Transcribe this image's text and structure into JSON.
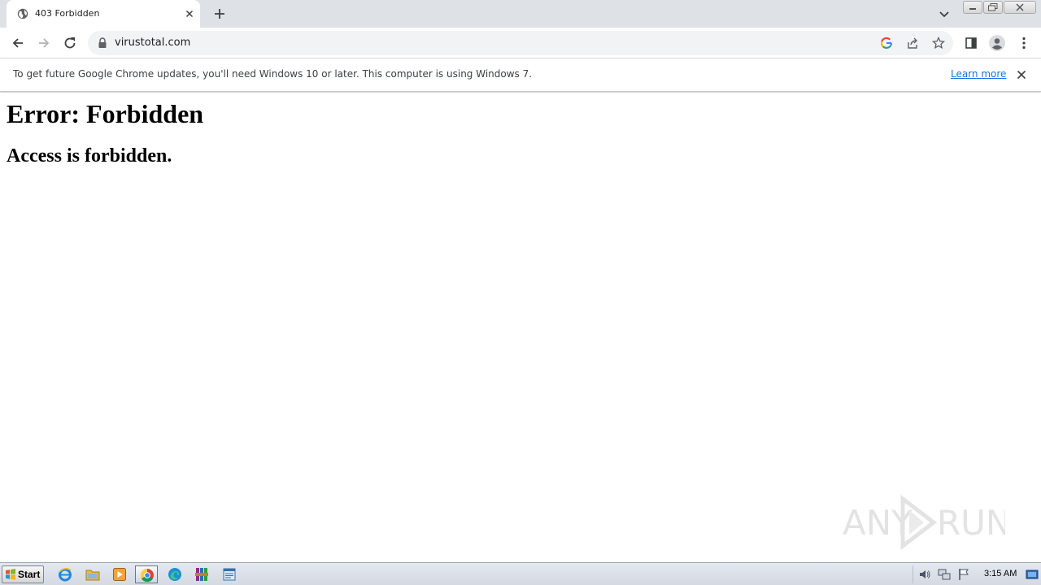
{
  "browser": {
    "tab": {
      "title": "403 Forbidden",
      "favicon": "globe-icon"
    },
    "omnibox": {
      "url": "virustotal.com"
    }
  },
  "infobar": {
    "message": "To get future Google Chrome updates, you'll need Windows 10 or later. This computer is using Windows 7.",
    "link_label": "Learn more"
  },
  "page": {
    "heading": "Error: Forbidden",
    "message": "Access is forbidden."
  },
  "watermark": {
    "text_left": "ANY",
    "text_right": "RUN"
  },
  "taskbar": {
    "start_label": "Start",
    "apps": [
      "internet-explorer-icon",
      "file-explorer-icon",
      "media-player-icon",
      "chrome-icon",
      "edge-icon",
      "winrar-icon",
      "notepad-icon"
    ],
    "clock": "3:15 AM"
  },
  "colors": {
    "link": "#1a73e8",
    "tabstrip": "#dee1e6",
    "omnibox": "#f1f3f4"
  }
}
